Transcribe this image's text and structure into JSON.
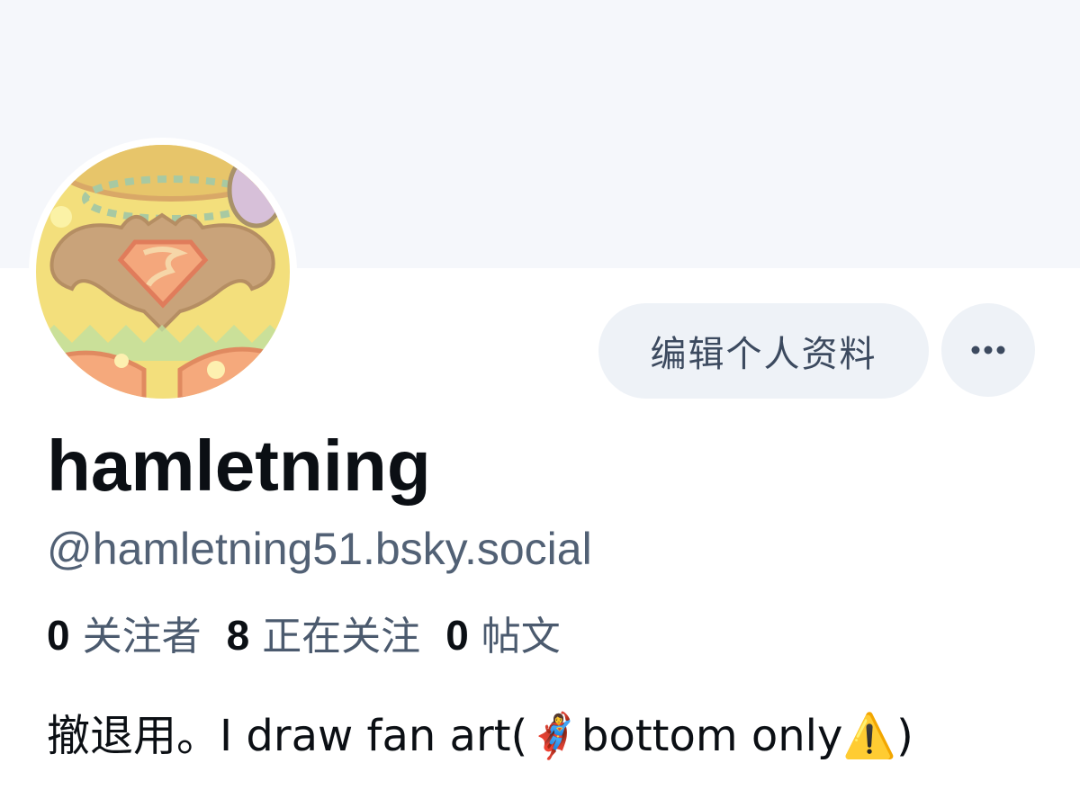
{
  "profile": {
    "display_name": "hamletning",
    "handle": "@hamletning51.bsky.social",
    "avatar_icon": "superman-batman-avatar",
    "bio": "撤退用。I draw fan art(🦸‍♀️bottom only⚠️)"
  },
  "actions": {
    "edit_profile_label": "编辑个人资料",
    "more_icon": "ellipsis-icon"
  },
  "stats": [
    {
      "count": "0",
      "label": "关注者"
    },
    {
      "count": "8",
      "label": "正在关注"
    },
    {
      "count": "0",
      "label": "帖文"
    }
  ],
  "colors": {
    "banner": "#f5f7fb",
    "button_bg": "#eef2f7",
    "secondary_text": "#526175",
    "primary_text": "#0b0f14"
  }
}
